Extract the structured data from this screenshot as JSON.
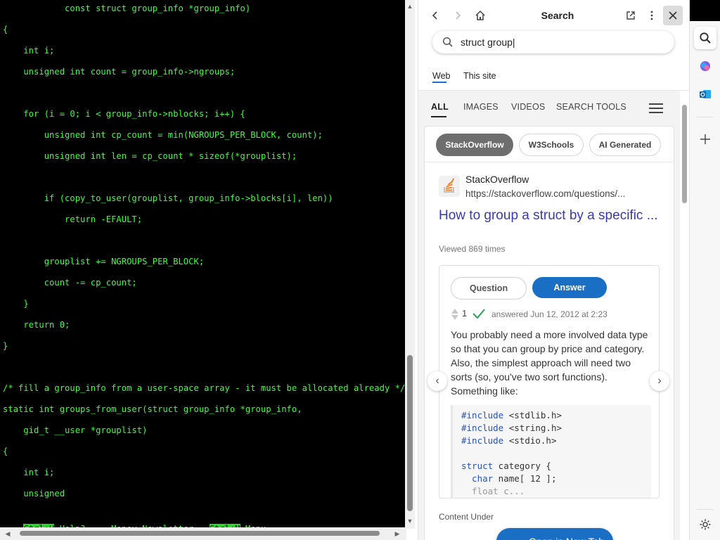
{
  "terminal": {
    "lines": [
      "            const struct group_info *group_info)",
      "{",
      "    int i;",
      "    unsigned int count = group_info->ngroups;",
      "",
      "    for (i = 0; i < group_info->nblocks; i++) {",
      "        unsigned int cp_count = min(NGROUPS_PER_BLOCK, count);",
      "        unsigned int len = cp_count * sizeof(*grouplist);",
      "",
      "        if (copy_to_user(grouplist, group_info->blocks[i], len))",
      "            return -EFAULT;",
      "",
      "        grouplist += NGROUPS_PER_BLOCK;",
      "        count -= cp_count;",
      "    }",
      "    return 0;",
      "}",
      "",
      "/* fill a group_info from a user-space array - it must be allocated already */",
      "static int groups_from_user(struct group_info *group_info,",
      "    gid_t __user *grouplist)",
      "{",
      "    int i;",
      "    unsigned"
    ],
    "status": {
      "key1": "Ctrl+H",
      "text1": " Help?     Money Newsletter   ",
      "key2": "Ctrl+M",
      "text2": " Menu"
    }
  },
  "panel": {
    "title": "Search",
    "query": "struct group|",
    "scope_tabs": [
      "Web",
      "This site"
    ],
    "result_tabs": [
      "ALL",
      "IMAGES",
      "VIDEOS",
      "SEARCH TOOLS"
    ],
    "chips": [
      "StackOverflow",
      "W3Schools",
      "AI Generated"
    ],
    "result": {
      "site": "StackOverflow",
      "url": "https://stackoverflow.com/questions/...",
      "title": "How to group a struct by a specific ...",
      "viewed": "Viewed 869 times",
      "toggle_question": "Question",
      "toggle_answer": "Answer",
      "votes": "1",
      "answered": "answered Jun 12, 2012 at 2:23",
      "answer_text": "You probably need a more involved data type so that you can group by price and category. Also, the simplest approach will need two sorts (so, you've two sort functions). Something like:",
      "code": {
        "include1_kw": "#include",
        "include1_val": " <stdlib.h>",
        "include2_kw": "#include",
        "include2_val": " <string.h>",
        "include3_kw": "#include",
        "include3_val": " <stdio.h>",
        "struct_kw": "struct",
        "struct_val": " category {",
        "char_kw": "  char",
        "char_val": " name[ 12 ];",
        "float_line": "  float c..."
      },
      "content_under": "Content Under"
    },
    "open_new_tab": "Open in New Tab"
  },
  "sidebar": {
    "items": [
      "search-icon",
      "copilot-icon",
      "outlook-icon",
      "add-icon",
      "settings-icon"
    ]
  },
  "colors": {
    "terminal_text": "#39ff39",
    "accent": "#1a6ec4",
    "link_title": "#3b3aa6"
  }
}
